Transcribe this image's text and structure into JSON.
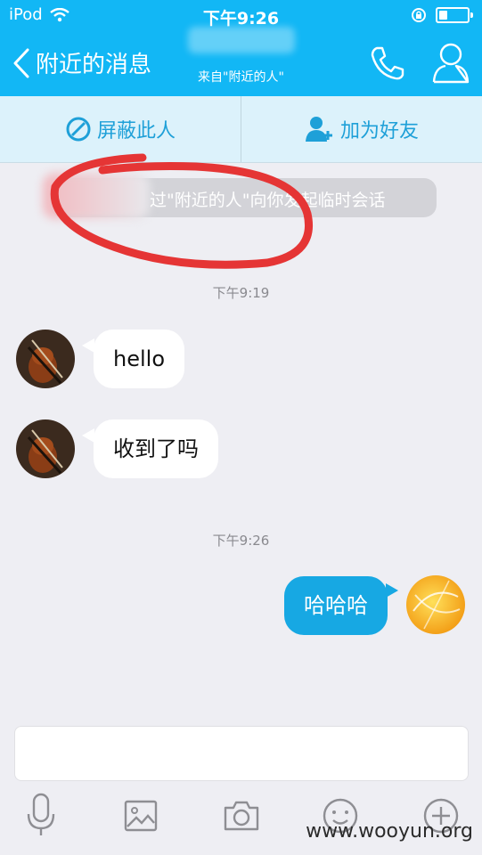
{
  "status_bar": {
    "carrier": "iPod",
    "time": "下午9:26",
    "wifi_icon": "wifi-icon",
    "rotation_icon": "rotation-lock-icon",
    "battery_icon": "battery-icon"
  },
  "nav": {
    "back_label": "附近的消息",
    "subtitle": "来自\"附近的人\"",
    "phone_icon": "phone-icon",
    "profile_icon": "profile-icon"
  },
  "actions": {
    "block_label": "屏蔽此人",
    "add_friend_label": "加为好友"
  },
  "chat": {
    "system_message": "过\"附近的人\"向你发起临时会话",
    "messages": [
      {
        "time": "下午9:19"
      },
      {
        "side": "left",
        "text": "hello"
      },
      {
        "side": "left",
        "text": "收到了吗"
      },
      {
        "time": "下午9:26"
      },
      {
        "side": "right",
        "text": "哈哈哈"
      }
    ]
  },
  "input": {
    "placeholder": ""
  },
  "toolbar": [
    "mic-icon",
    "image-icon",
    "camera-icon",
    "emoji-icon",
    "plus-icon"
  ],
  "watermark": "www.wooyun.org",
  "colors": {
    "brand_blue": "#12b7f5",
    "bubble_me": "#17a8e3",
    "annotation_red": "#e53535"
  }
}
